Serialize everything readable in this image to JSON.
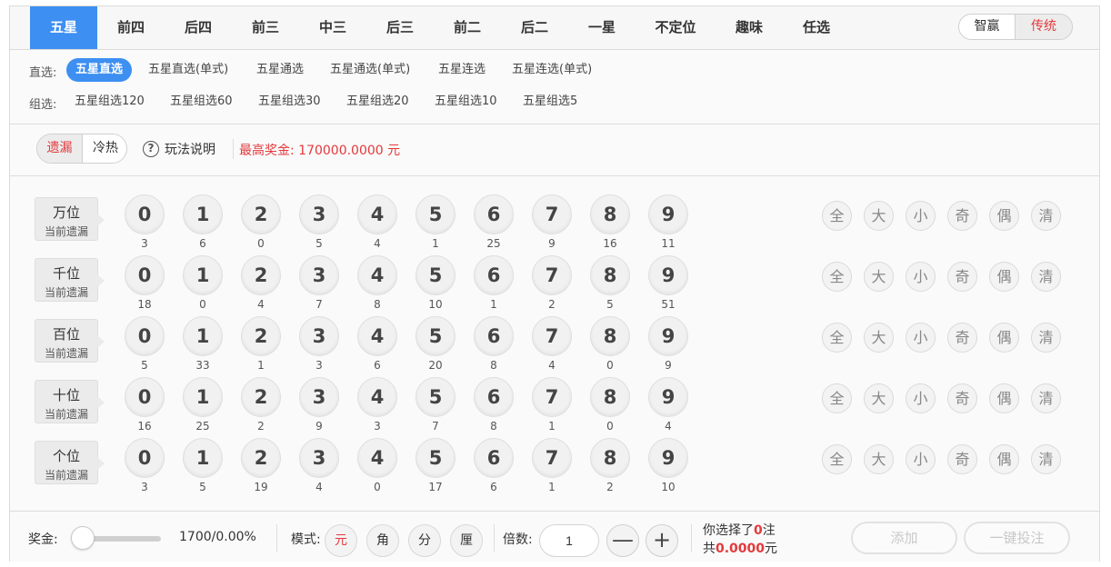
{
  "tabs": [
    "五星",
    "前四",
    "后四",
    "前三",
    "中三",
    "后三",
    "前二",
    "后二",
    "一星",
    "不定位",
    "趣味",
    "任选"
  ],
  "active_tab": 0,
  "mode_toggle": {
    "smart": "智赢",
    "classic": "传统"
  },
  "subtabs": {
    "direct_label": "直选:",
    "direct": [
      "五星直选",
      "五星直选(单式)",
      "五星通选",
      "五星通选(单式)",
      "五星连选",
      "五星连选(单式)"
    ],
    "group_label": "组选:",
    "group": [
      "五星组选120",
      "五星组选60",
      "五星组选30",
      "五星组选20",
      "五星组选10",
      "五星组选5"
    ]
  },
  "info": {
    "omission": "遗漏",
    "hotcold": "冷热",
    "help_icon": "question-circle-icon",
    "help_text": "玩法说明",
    "max_prize": "最高奖金: 170000.0000 元"
  },
  "digits": [
    "0",
    "1",
    "2",
    "3",
    "4",
    "5",
    "6",
    "7",
    "8",
    "9"
  ],
  "quick": [
    "全",
    "大",
    "小",
    "奇",
    "偶",
    "清"
  ],
  "rows": [
    {
      "name": "万位",
      "sub": "当前遗漏",
      "miss": [
        "3",
        "6",
        "0",
        "5",
        "4",
        "1",
        "25",
        "9",
        "16",
        "11"
      ]
    },
    {
      "name": "千位",
      "sub": "当前遗漏",
      "miss": [
        "18",
        "0",
        "4",
        "7",
        "8",
        "10",
        "1",
        "2",
        "5",
        "51"
      ]
    },
    {
      "name": "百位",
      "sub": "当前遗漏",
      "miss": [
        "5",
        "33",
        "1",
        "3",
        "6",
        "20",
        "8",
        "4",
        "0",
        "9"
      ]
    },
    {
      "name": "十位",
      "sub": "当前遗漏",
      "miss": [
        "16",
        "25",
        "2",
        "9",
        "3",
        "7",
        "8",
        "1",
        "0",
        "4"
      ]
    },
    {
      "name": "个位",
      "sub": "当前遗漏",
      "miss": [
        "3",
        "5",
        "19",
        "4",
        "0",
        "17",
        "6",
        "1",
        "2",
        "10"
      ]
    }
  ],
  "bottom": {
    "prize_label": "奖金:",
    "rebate_slider_fraction": 0,
    "prize_value": "1700/0.00%",
    "mode_label": "模式:",
    "modes": [
      "元",
      "角",
      "分",
      "厘"
    ],
    "active_mode": 0,
    "multiple_label": "倍数:",
    "multiple_value": "1",
    "minus": "—",
    "plus": "+",
    "selected_pre": "你选择了",
    "selected_count": "0",
    "selected_post": "注",
    "total_pre": "共",
    "total_amount": "0.0000",
    "total_post": "元",
    "add_button": "添加",
    "bet_button": "一键投注"
  },
  "colors": {
    "accent": "#3d8ff2",
    "red": "#e4393c"
  }
}
